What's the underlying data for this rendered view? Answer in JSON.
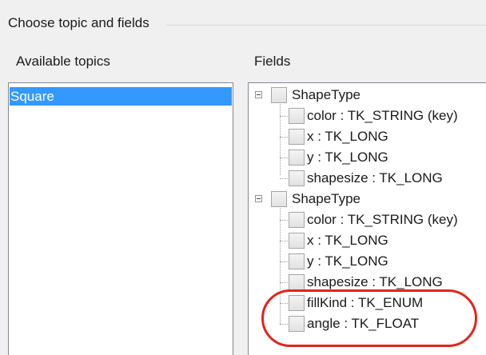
{
  "panel": {
    "title": "Choose topic and fields"
  },
  "topics": {
    "label": "Available topics",
    "items": [
      "Square"
    ]
  },
  "fields": {
    "label": "Fields",
    "tree": [
      {
        "label": "ShapeType",
        "children": [
          "color : TK_STRING (key)",
          "x : TK_LONG",
          "y : TK_LONG",
          "shapesize : TK_LONG"
        ]
      },
      {
        "label": "ShapeType",
        "children": [
          "color : TK_STRING (key)",
          "x : TK_LONG",
          "y : TK_LONG",
          "shapesize : TK_LONG",
          "fillKind : TK_ENUM",
          "angle : TK_FLOAT"
        ]
      }
    ]
  },
  "colors": {
    "selection": "#3399ff",
    "highlight": "#e0261c"
  },
  "icons": {
    "expander": "minus-expander-icon"
  }
}
